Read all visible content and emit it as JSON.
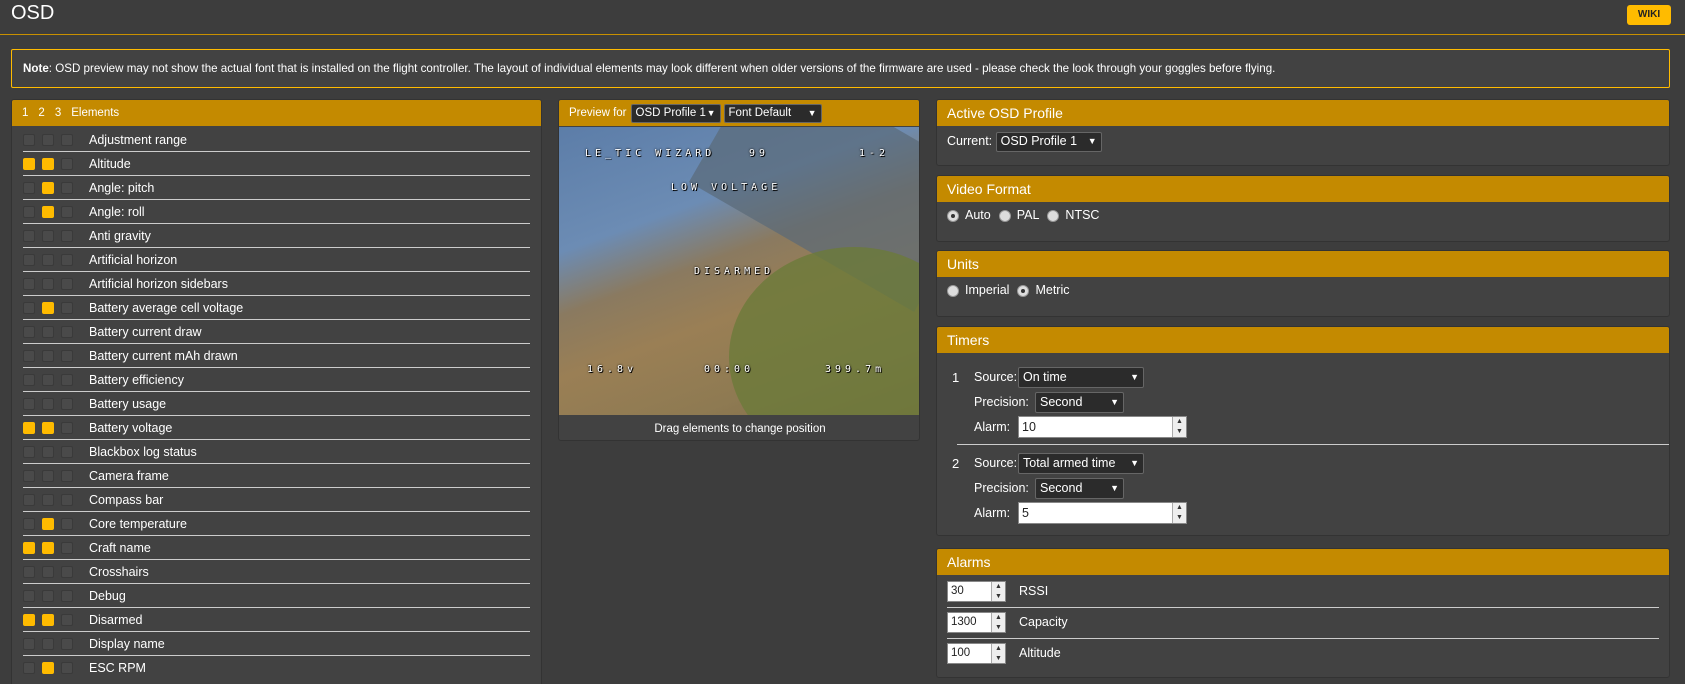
{
  "header": {
    "title": "OSD",
    "wiki_label": "WIKI"
  },
  "note": {
    "bold": "Note",
    "text": ": OSD preview may not show the actual font that is installed on the flight controller. The layout of individual elements may look different when older versions of the firmware are used - please check the look through your goggles before flying."
  },
  "elements_panel": {
    "profile_cols": [
      "1",
      "2",
      "3"
    ],
    "title": "Elements",
    "items": [
      {
        "label": "Adjustment range",
        "p1": false,
        "p2": false,
        "p3": false
      },
      {
        "label": "Altitude",
        "p1": true,
        "p2": true,
        "p3": false
      },
      {
        "label": "Angle: pitch",
        "p1": false,
        "p2": true,
        "p3": false
      },
      {
        "label": "Angle: roll",
        "p1": false,
        "p2": true,
        "p3": false
      },
      {
        "label": "Anti gravity",
        "p1": false,
        "p2": false,
        "p3": false
      },
      {
        "label": "Artificial horizon",
        "p1": false,
        "p2": false,
        "p3": false
      },
      {
        "label": "Artificial horizon sidebars",
        "p1": false,
        "p2": false,
        "p3": false
      },
      {
        "label": "Battery average cell voltage",
        "p1": false,
        "p2": true,
        "p3": false
      },
      {
        "label": "Battery current draw",
        "p1": false,
        "p2": false,
        "p3": false
      },
      {
        "label": "Battery current mAh drawn",
        "p1": false,
        "p2": false,
        "p3": false
      },
      {
        "label": "Battery efficiency",
        "p1": false,
        "p2": false,
        "p3": false
      },
      {
        "label": "Battery usage",
        "p1": false,
        "p2": false,
        "p3": false
      },
      {
        "label": "Battery voltage",
        "p1": true,
        "p2": true,
        "p3": false
      },
      {
        "label": "Blackbox log status",
        "p1": false,
        "p2": false,
        "p3": false
      },
      {
        "label": "Camera frame",
        "p1": false,
        "p2": false,
        "p3": false
      },
      {
        "label": "Compass bar",
        "p1": false,
        "p2": false,
        "p3": false
      },
      {
        "label": "Core temperature",
        "p1": false,
        "p2": true,
        "p3": false
      },
      {
        "label": "Craft name",
        "p1": true,
        "p2": true,
        "p3": false
      },
      {
        "label": "Crosshairs",
        "p1": false,
        "p2": false,
        "p3": false
      },
      {
        "label": "Debug",
        "p1": false,
        "p2": false,
        "p3": false
      },
      {
        "label": "Disarmed",
        "p1": true,
        "p2": true,
        "p3": false
      },
      {
        "label": "Display name",
        "p1": false,
        "p2": false,
        "p3": false
      },
      {
        "label": "ESC RPM",
        "p1": false,
        "p2": true,
        "p3": false
      }
    ]
  },
  "preview": {
    "label": "Preview for",
    "profile_select": "OSD Profile 1",
    "font_select": "Font Default",
    "osd_craft": "LE_TIC WIZARD",
    "osd_rssi": "99",
    "osd_profile": "1-2",
    "osd_warning": "LOW VOLTAGE",
    "osd_disarmed": "DISARMED",
    "osd_voltage": "16.8v",
    "osd_timer": "00:00",
    "osd_alt": "399.7m",
    "drag_hint": "Drag elements to change position"
  },
  "active_profile": {
    "title": "Active OSD Profile",
    "current_label": "Current:",
    "current_value": "OSD Profile 1"
  },
  "video_format": {
    "title": "Video Format",
    "options": [
      "Auto",
      "PAL",
      "NTSC"
    ],
    "selected": "Auto"
  },
  "units": {
    "title": "Units",
    "options": [
      "Imperial",
      "Metric"
    ],
    "selected": "Metric"
  },
  "timers": {
    "title": "Timers",
    "items": [
      {
        "num": "1",
        "source_label": "Source:",
        "source": "On time",
        "precision_label": "Precision:",
        "precision": "Second",
        "alarm_label": "Alarm:",
        "alarm": "10"
      },
      {
        "num": "2",
        "source_label": "Source:",
        "source": "Total armed time",
        "precision_label": "Precision:",
        "precision": "Second",
        "alarm_label": "Alarm:",
        "alarm": "5"
      }
    ]
  },
  "alarms": {
    "title": "Alarms",
    "items": [
      {
        "value": "30",
        "label": "RSSI"
      },
      {
        "value": "1300",
        "label": "Capacity"
      },
      {
        "value": "100",
        "label": "Altitude"
      }
    ]
  },
  "colors": {
    "accent": "#ffbb00",
    "panel_header": "#c48a00",
    "background": "#3d3d3d"
  }
}
